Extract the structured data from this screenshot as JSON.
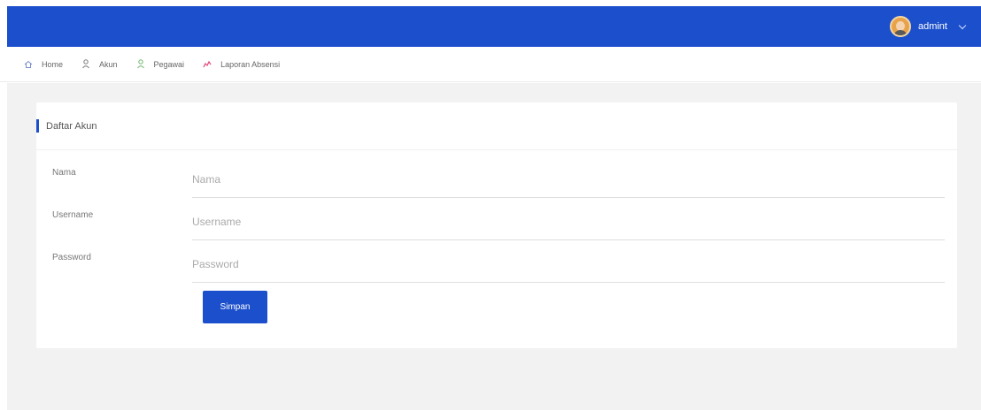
{
  "header": {
    "username": "admint"
  },
  "nav": {
    "items": [
      {
        "label": "Home",
        "icon": "home-icon"
      },
      {
        "label": "Akun",
        "icon": "user-icon"
      },
      {
        "label": "Pegawai",
        "icon": "employee-icon"
      },
      {
        "label": "Laporan Absensi",
        "icon": "report-icon"
      }
    ]
  },
  "card": {
    "title": "Daftar Akun",
    "fields": [
      {
        "label": "Nama",
        "placeholder": "Nama"
      },
      {
        "label": "Username",
        "placeholder": "Username"
      },
      {
        "label": "Password",
        "placeholder": "Password"
      }
    ],
    "submit_label": "Simpan"
  },
  "colors": {
    "primary": "#1c4fcc",
    "background": "#f2f2f2"
  }
}
